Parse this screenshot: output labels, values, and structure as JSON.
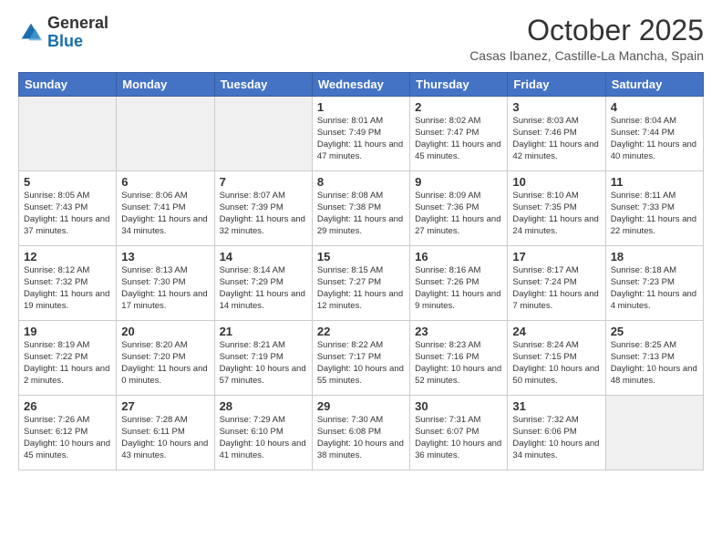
{
  "logo": {
    "general": "General",
    "blue": "Blue"
  },
  "header": {
    "month": "October 2025",
    "location": "Casas Ibanez, Castille-La Mancha, Spain"
  },
  "weekdays": [
    "Sunday",
    "Monday",
    "Tuesday",
    "Wednesday",
    "Thursday",
    "Friday",
    "Saturday"
  ],
  "weeks": [
    [
      {
        "day": "",
        "info": ""
      },
      {
        "day": "",
        "info": ""
      },
      {
        "day": "",
        "info": ""
      },
      {
        "day": "1",
        "info": "Sunrise: 8:01 AM\nSunset: 7:49 PM\nDaylight: 11 hours\nand 47 minutes."
      },
      {
        "day": "2",
        "info": "Sunrise: 8:02 AM\nSunset: 7:47 PM\nDaylight: 11 hours\nand 45 minutes."
      },
      {
        "day": "3",
        "info": "Sunrise: 8:03 AM\nSunset: 7:46 PM\nDaylight: 11 hours\nand 42 minutes."
      },
      {
        "day": "4",
        "info": "Sunrise: 8:04 AM\nSunset: 7:44 PM\nDaylight: 11 hours\nand 40 minutes."
      }
    ],
    [
      {
        "day": "5",
        "info": "Sunrise: 8:05 AM\nSunset: 7:43 PM\nDaylight: 11 hours\nand 37 minutes."
      },
      {
        "day": "6",
        "info": "Sunrise: 8:06 AM\nSunset: 7:41 PM\nDaylight: 11 hours\nand 34 minutes."
      },
      {
        "day": "7",
        "info": "Sunrise: 8:07 AM\nSunset: 7:39 PM\nDaylight: 11 hours\nand 32 minutes."
      },
      {
        "day": "8",
        "info": "Sunrise: 8:08 AM\nSunset: 7:38 PM\nDaylight: 11 hours\nand 29 minutes."
      },
      {
        "day": "9",
        "info": "Sunrise: 8:09 AM\nSunset: 7:36 PM\nDaylight: 11 hours\nand 27 minutes."
      },
      {
        "day": "10",
        "info": "Sunrise: 8:10 AM\nSunset: 7:35 PM\nDaylight: 11 hours\nand 24 minutes."
      },
      {
        "day": "11",
        "info": "Sunrise: 8:11 AM\nSunset: 7:33 PM\nDaylight: 11 hours\nand 22 minutes."
      }
    ],
    [
      {
        "day": "12",
        "info": "Sunrise: 8:12 AM\nSunset: 7:32 PM\nDaylight: 11 hours\nand 19 minutes."
      },
      {
        "day": "13",
        "info": "Sunrise: 8:13 AM\nSunset: 7:30 PM\nDaylight: 11 hours\nand 17 minutes."
      },
      {
        "day": "14",
        "info": "Sunrise: 8:14 AM\nSunset: 7:29 PM\nDaylight: 11 hours\nand 14 minutes."
      },
      {
        "day": "15",
        "info": "Sunrise: 8:15 AM\nSunset: 7:27 PM\nDaylight: 11 hours\nand 12 minutes."
      },
      {
        "day": "16",
        "info": "Sunrise: 8:16 AM\nSunset: 7:26 PM\nDaylight: 11 hours\nand 9 minutes."
      },
      {
        "day": "17",
        "info": "Sunrise: 8:17 AM\nSunset: 7:24 PM\nDaylight: 11 hours\nand 7 minutes."
      },
      {
        "day": "18",
        "info": "Sunrise: 8:18 AM\nSunset: 7:23 PM\nDaylight: 11 hours\nand 4 minutes."
      }
    ],
    [
      {
        "day": "19",
        "info": "Sunrise: 8:19 AM\nSunset: 7:22 PM\nDaylight: 11 hours\nand 2 minutes."
      },
      {
        "day": "20",
        "info": "Sunrise: 8:20 AM\nSunset: 7:20 PM\nDaylight: 11 hours\nand 0 minutes."
      },
      {
        "day": "21",
        "info": "Sunrise: 8:21 AM\nSunset: 7:19 PM\nDaylight: 10 hours\nand 57 minutes."
      },
      {
        "day": "22",
        "info": "Sunrise: 8:22 AM\nSunset: 7:17 PM\nDaylight: 10 hours\nand 55 minutes."
      },
      {
        "day": "23",
        "info": "Sunrise: 8:23 AM\nSunset: 7:16 PM\nDaylight: 10 hours\nand 52 minutes."
      },
      {
        "day": "24",
        "info": "Sunrise: 8:24 AM\nSunset: 7:15 PM\nDaylight: 10 hours\nand 50 minutes."
      },
      {
        "day": "25",
        "info": "Sunrise: 8:25 AM\nSunset: 7:13 PM\nDaylight: 10 hours\nand 48 minutes."
      }
    ],
    [
      {
        "day": "26",
        "info": "Sunrise: 7:26 AM\nSunset: 6:12 PM\nDaylight: 10 hours\nand 45 minutes."
      },
      {
        "day": "27",
        "info": "Sunrise: 7:28 AM\nSunset: 6:11 PM\nDaylight: 10 hours\nand 43 minutes."
      },
      {
        "day": "28",
        "info": "Sunrise: 7:29 AM\nSunset: 6:10 PM\nDaylight: 10 hours\nand 41 minutes."
      },
      {
        "day": "29",
        "info": "Sunrise: 7:30 AM\nSunset: 6:08 PM\nDaylight: 10 hours\nand 38 minutes."
      },
      {
        "day": "30",
        "info": "Sunrise: 7:31 AM\nSunset: 6:07 PM\nDaylight: 10 hours\nand 36 minutes."
      },
      {
        "day": "31",
        "info": "Sunrise: 7:32 AM\nSunset: 6:06 PM\nDaylight: 10 hours\nand 34 minutes."
      },
      {
        "day": "",
        "info": ""
      }
    ]
  ]
}
